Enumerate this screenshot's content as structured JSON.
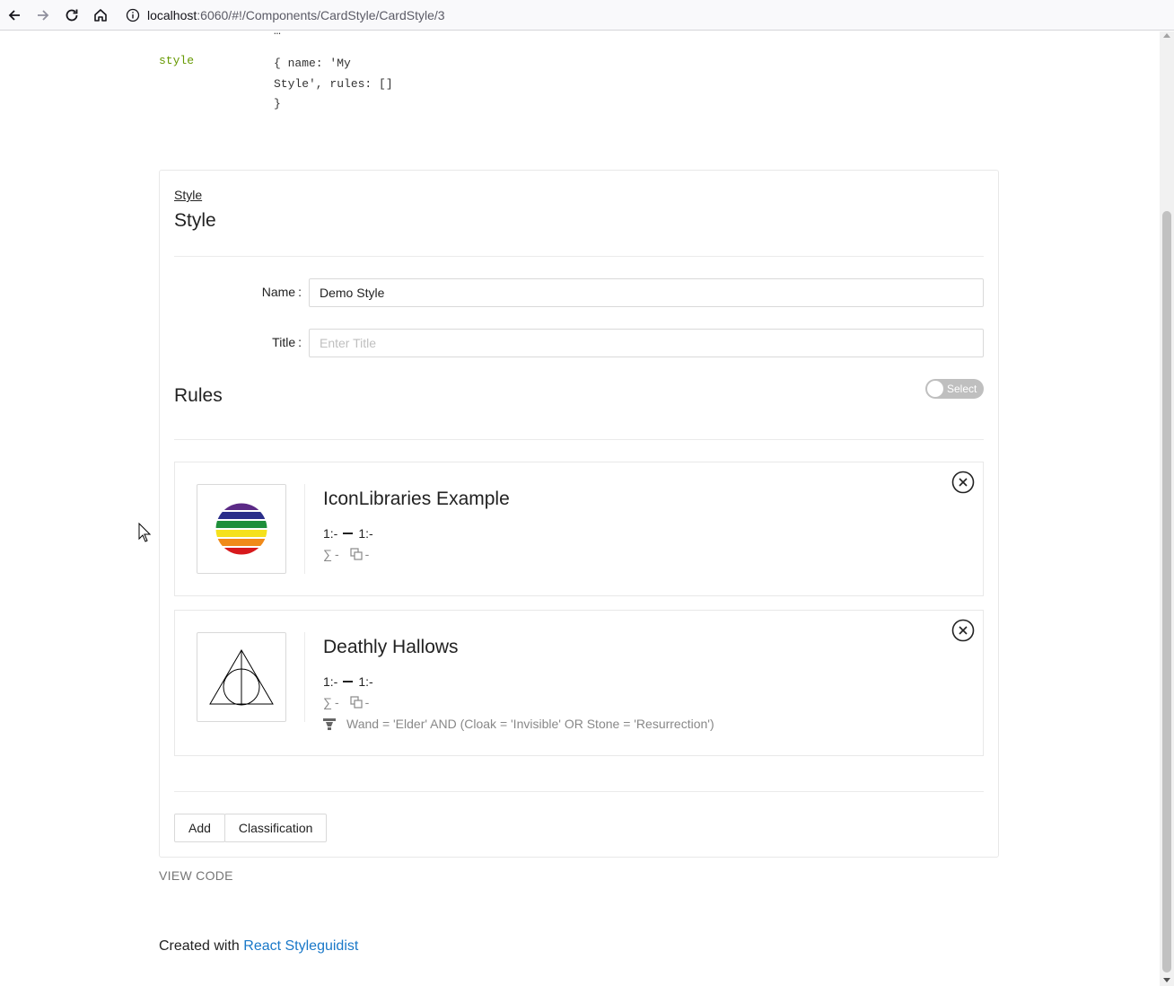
{
  "browser": {
    "url_host": "localhost",
    "url_rest": ":6060/#!/Components/CardStyle/CardStyle/3"
  },
  "props": {
    "cut_text": "…",
    "name": "style",
    "default_lines": [
      "{ name: 'My",
      "Style', rules: []",
      "}"
    ]
  },
  "card": {
    "breadcrumb": "Style",
    "title": "Style",
    "name_label": "Name",
    "name_value": "Demo Style",
    "title_label": "Title",
    "title_placeholder": "Enter Title",
    "rules_title": "Rules",
    "select_label": "Select",
    "rules": [
      {
        "name": "IconLibraries Example",
        "scale_min": "1:-",
        "scale_max": "1:-",
        "sum_value": "-",
        "copy_value": "-",
        "icon": "rainbow-circle-icon"
      },
      {
        "name": "Deathly Hallows",
        "scale_min": "1:-",
        "scale_max": "1:-",
        "sum_value": "-",
        "copy_value": "-",
        "filter": "Wand = 'Elder' AND (Cloak = 'Invisible' OR Stone = 'Resurrection')",
        "icon": "deathly-hallows-icon"
      }
    ],
    "add_label": "Add",
    "classification_label": "Classification"
  },
  "view_code": "VIEW CODE",
  "footer": {
    "prefix": "Created with ",
    "link": "React Styleguidist"
  },
  "colors": {
    "link": "#1978c8",
    "prop_name": "#669900",
    "switch_off": "#bfbfbf"
  }
}
